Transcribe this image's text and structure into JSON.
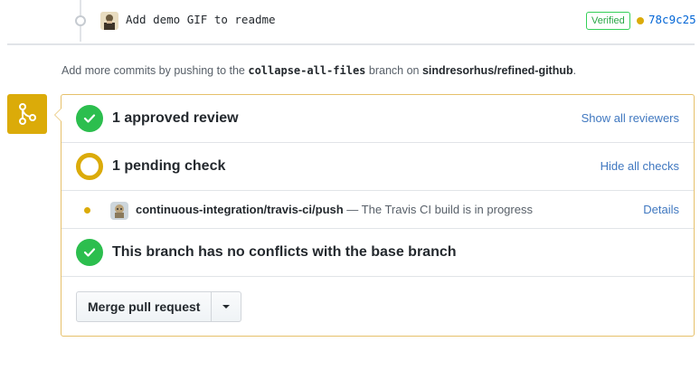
{
  "commit": {
    "message": "Add demo GIF to readme",
    "verified_label": "Verified",
    "sha": "78c9c25"
  },
  "push_hint": {
    "prefix": "Add more commits by pushing to the ",
    "branch": "collapse-all-files",
    "middle": " branch on ",
    "repo": "sindresorhus/refined-github",
    "suffix": "."
  },
  "merge_box": {
    "reviews": {
      "title": "1 approved review",
      "link": "Show all reviewers"
    },
    "checks": {
      "title": "1 pending check",
      "link": "Hide all checks"
    },
    "ci_item": {
      "context": "continuous-integration/travis-ci/push",
      "description": " — The Travis CI build is in progress",
      "details_label": "Details"
    },
    "conflicts": {
      "title": "This branch has no conflicts with the base branch"
    },
    "merge_button_label": "Merge pull request"
  },
  "colors": {
    "pending": "#dbab09",
    "success": "#2cbe4e",
    "link": "#4078c0"
  }
}
